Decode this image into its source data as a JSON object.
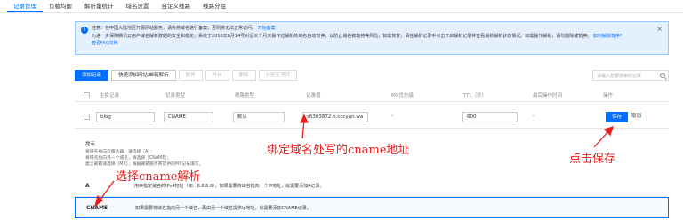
{
  "tabs": [
    "记录管理",
    "负载均衡",
    "解析量统计",
    "域名设置",
    "自定义线路",
    "线路分组"
  ],
  "notice": {
    "line1": "注意：在中国大陆地区开展网站服务，请先将域名进行备案，否则将无法正常访问。",
    "line1_link": "开始备案",
    "line2": "为进一步保障腾讯云用户域名解析数据的安全和稳定，系统于2018年8月14号对近三个月未操作过解析的域名自动暂停，以防止域名被劫持等风险，如需恢复，请在解析记录中点击开启解析记录并查看最新解析状态情况。如需操作解析，请勿删除或暂停。",
    "line2_link": "如何解除暂停？",
    "line3_link": "查看FAQ文档"
  },
  "toolbar": {
    "add": "添加记录",
    "quick_add": "快速添加网站/邮箱解析",
    "pause": "暂停",
    "enable": "开启",
    "delete": "删除",
    "assign": "分配至项目",
    "search_placeholder": "请输入您要搜索的记录"
  },
  "columns": [
    "主机记录",
    "记录类型",
    "线路类型",
    "记录值",
    "MX优先级",
    "TTL（秒）",
    "最后操作时间",
    "操作"
  ],
  "edit_row": {
    "host": "blog",
    "type": "CNAME",
    "line": "默认",
    "value": "s6303872.n.cccyun.wa",
    "mx": "-",
    "ttl": "600",
    "time": "-",
    "save": "保存",
    "cancel": "取消"
  },
  "tips": {
    "title": "提示",
    "lines": [
      "将域名指向云服务器，请选择［A］；",
      "将域名指向另一个域名，请选择［CNAME］；",
      "建立邮箱请选择［MX］，根据邮箱服务商提供的MX记录填写。"
    ]
  },
  "record_types": [
    {
      "name": "A",
      "desc": "用来指定域名的IPv4地址（如：8.8.8.8），如果需要将域名指向一个IP地址，就需要添加A记录。"
    },
    {
      "name": "CNAME",
      "desc": "如果需要将域名指向另一个域名，再由另一个域名提供ip地址，就需要添加CNAME记录。"
    }
  ],
  "annotations": {
    "value_note": "绑定域名处写的cname地址",
    "save_note": "点击保存",
    "type_note": "选择cname解析",
    "color": "#e8201e"
  },
  "colors": {
    "accent": "#006eff"
  }
}
